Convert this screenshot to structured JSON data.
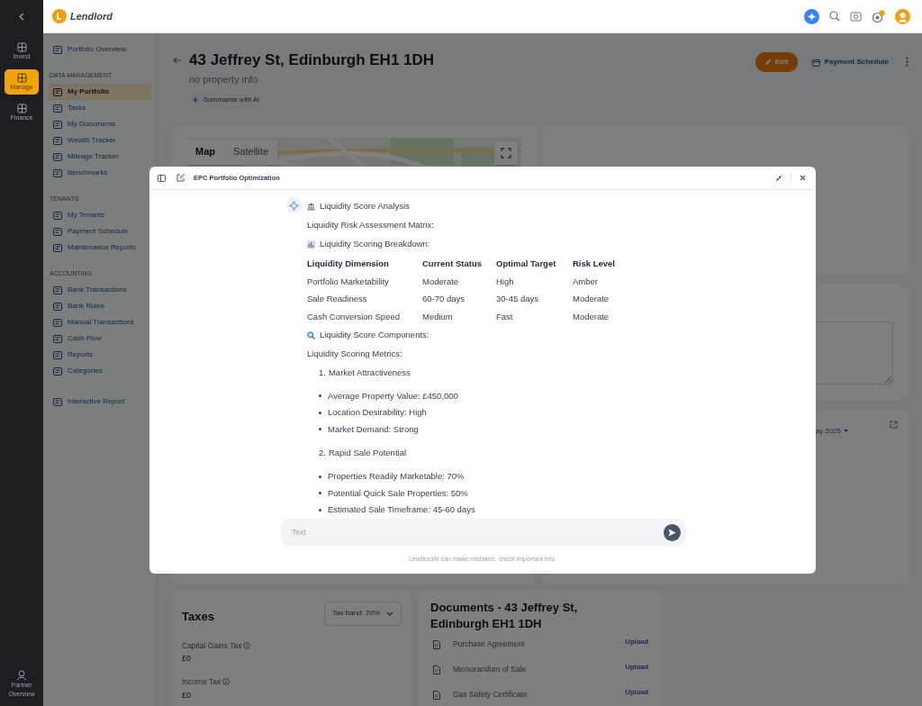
{
  "rail": {
    "items": [
      {
        "label": "Invest",
        "selected": false
      },
      {
        "label": "Manage",
        "selected": true
      },
      {
        "label": "Finance",
        "selected": false
      }
    ],
    "bottom_item": "Partner Overview"
  },
  "header": {
    "logo": "Lendlord"
  },
  "sidebar": {
    "sections": [
      {
        "items": [
          {
            "label": "Portfolio Overview",
            "selected": false
          }
        ]
      },
      {
        "title": "DATA MANAGEMENT",
        "items": [
          {
            "label": "My Portfolio",
            "selected": true
          },
          {
            "label": "Tasks",
            "selected": false
          },
          {
            "label": "My Documents",
            "selected": false
          },
          {
            "label": "Wealth Tracker",
            "selected": false
          },
          {
            "label": "Mileage Tracker",
            "selected": false
          },
          {
            "label": "Benchmarks",
            "selected": false
          }
        ]
      },
      {
        "title": "TENANTS",
        "items": [
          {
            "label": "My Tenants",
            "selected": false
          },
          {
            "label": "Payment Schedule",
            "selected": false
          },
          {
            "label": "Maintenance Reports",
            "selected": false
          }
        ]
      },
      {
        "title": "ACCOUNTING",
        "items": [
          {
            "label": "Bank Transactions",
            "selected": false
          },
          {
            "label": "Bank Rules",
            "selected": false
          },
          {
            "label": "Manual Transactions",
            "selected": false
          },
          {
            "label": "Cash Flow",
            "selected": false
          },
          {
            "label": "Reports",
            "selected": false
          },
          {
            "label": "Categories",
            "selected": false
          }
        ]
      },
      {
        "items": [
          {
            "label": "Interactive Report",
            "selected": false
          }
        ]
      }
    ]
  },
  "property": {
    "title": "43 Jeffrey St, Edinburgh EH1 1DH",
    "subtitle": "no property info",
    "summarise_button": "Summarise with AI",
    "edit_button": "Edit",
    "schedule_button": "Payment Schedule"
  },
  "map": {
    "types": [
      {
        "label": "Map",
        "selected": true
      },
      {
        "label": "Satellite",
        "selected": false
      }
    ]
  },
  "period_card": {
    "date_select": "ay 2025"
  },
  "taxes": {
    "title": "Taxes",
    "tax_band": "Tax band: 20%",
    "items": [
      {
        "label": "Capital Gains Tax",
        "value": "£0"
      },
      {
        "label": "Income Tax",
        "value": "£0"
      }
    ]
  },
  "documents": {
    "title": "Documents - 43 Jeffrey St, Edinburgh EH1 1DH",
    "items": [
      {
        "name": "Purchase Agreement",
        "action": "Upload"
      },
      {
        "name": "Memorandum of Sale",
        "action": "Upload"
      },
      {
        "name": "Gas Safety Certificate",
        "action": "Upload"
      }
    ]
  },
  "dialog": {
    "title": "EPC Portfolio Optimization",
    "blocks": [
      {
        "kind": "heading",
        "text": "Liquidity Score Analysis"
      },
      {
        "kind": "text",
        "text": "Liquidity Risk Assessment Matrix:"
      },
      {
        "kind": "heading",
        "text": "Liquidity Scoring Breakdown:"
      },
      {
        "kind": "table",
        "columns": [
          "Liquidity Dimension",
          "Current Status",
          "Optimal Target",
          "Risk Level"
        ],
        "rows": [
          [
            "Portfolio Marketability",
            "Moderate",
            "High",
            "Amber"
          ],
          [
            "Sale Readiness",
            "60-70 days",
            "30-45 days",
            "Moderate"
          ],
          [
            "Cash Conversion Speed",
            "Medium",
            "Fast",
            "Moderate"
          ]
        ]
      },
      {
        "kind": "heading",
        "text": "Liquidity Score Components:"
      },
      {
        "kind": "text",
        "text": "Liquidity Scoring Metrics:"
      },
      {
        "kind": "numbered",
        "number": "1.",
        "text": "Market Attractiveness"
      },
      {
        "kind": "bullets",
        "items": [
          "Average Property Value: £450,000",
          "Location Desirability: High",
          "Market Demand: Strong"
        ]
      },
      {
        "kind": "numbered",
        "number": "2.",
        "text": "Rapid Sale Potential"
      },
      {
        "kind": "bullets",
        "items": [
          "Properties Readily Marketable: 70%",
          "Potential Quick Sale Properties: 50%",
          "Estimated Sale Timeframe: 45-60 days"
        ]
      }
    ],
    "input_placeholder": "Text",
    "disclaimer": "LendlordAI can make mistakes, check important info."
  }
}
